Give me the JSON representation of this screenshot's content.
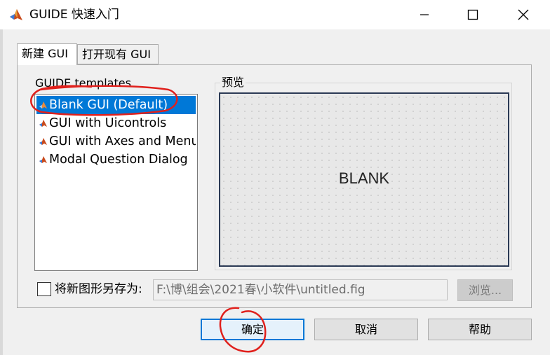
{
  "window": {
    "title": "GUIDE 快速入门",
    "icon": "matlab-icon",
    "controls": {
      "minimize": "minimize-icon",
      "maximize": "maximize-icon",
      "close": "close-icon"
    }
  },
  "tabs": [
    {
      "label": "新建 GUI",
      "active": true
    },
    {
      "label": "打开现有 GUI",
      "active": false
    }
  ],
  "templates": {
    "label": "GUIDE templates",
    "items": [
      {
        "label": "Blank GUI (Default)",
        "selected": true
      },
      {
        "label": "GUI with Uicontrols",
        "selected": false
      },
      {
        "label": "GUI with Axes and Menu",
        "selected": false
      },
      {
        "label": "Modal Question Dialog",
        "selected": false
      }
    ]
  },
  "preview": {
    "label": "预览",
    "content": "BLANK"
  },
  "save": {
    "checked": false,
    "label": "将新图形另存为:",
    "path": "F:\\博\\组会\\2021春\\小软件\\untitled.fig",
    "browse_label": "浏览..."
  },
  "buttons": {
    "ok": "确定",
    "cancel": "取消",
    "help": "帮助"
  },
  "colors": {
    "selection": "#0078d7",
    "annotation": "#e0201c",
    "preview_border": "#2b3a55"
  }
}
